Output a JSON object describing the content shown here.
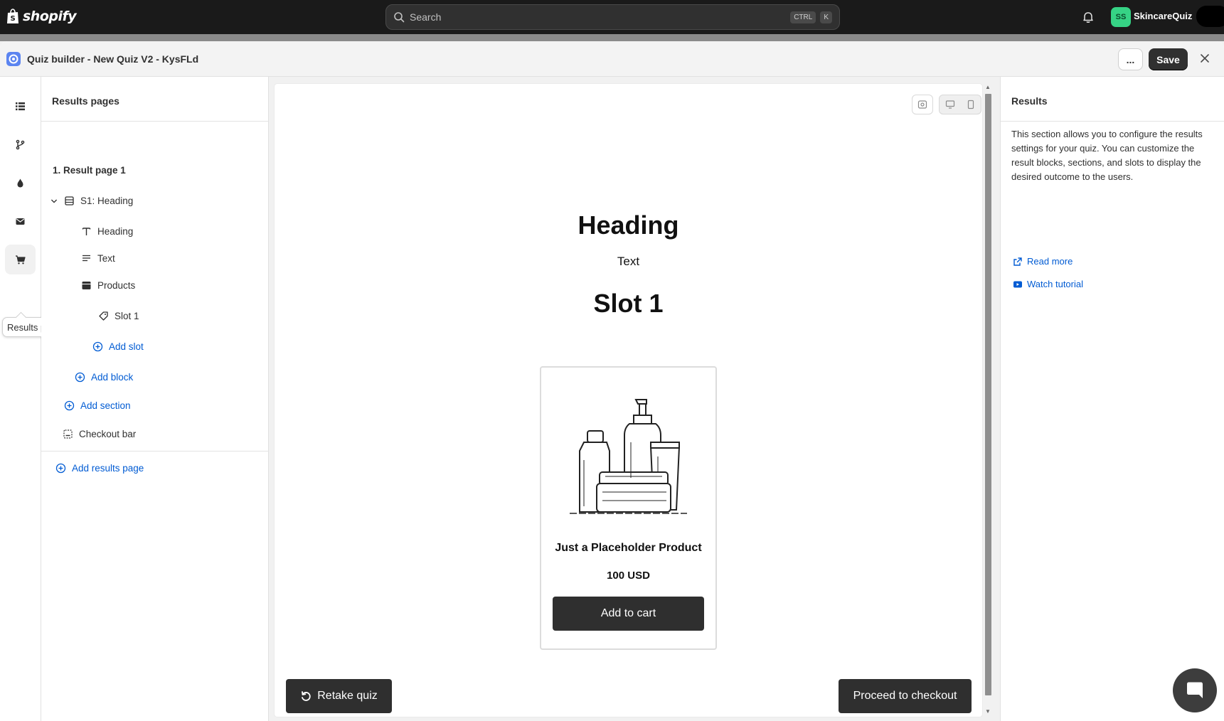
{
  "topbar": {
    "brand": "shopify",
    "search_placeholder": "Search",
    "shortcut_ctrl": "CTRL",
    "shortcut_k": "K",
    "avatar_initials": "SS",
    "store_name": "SkincareQuiz"
  },
  "modal": {
    "title": "Quiz builder - New Quiz V2 - KysFLd",
    "more_label": "...",
    "save_label": "Save"
  },
  "rail": {
    "tooltip": "Results pages"
  },
  "left_panel": {
    "title": "Results pages",
    "page_item": "1. Result page 1",
    "section_item": "S1: Heading",
    "blocks": [
      "Heading",
      "Text",
      "Products"
    ],
    "slot_item": "Slot 1",
    "add_slot": "Add slot",
    "add_block": "Add block",
    "add_section": "Add section",
    "checkout_bar": "Checkout bar",
    "add_results_page": "Add results page"
  },
  "preview": {
    "heading": "Heading",
    "text": "Text",
    "slot_title": "Slot 1",
    "product_name": "Just a Placeholder Product",
    "product_price": "100 USD",
    "add_to_cart": "Add to cart",
    "retake": "Retake quiz",
    "checkout": "Proceed to checkout"
  },
  "right_panel": {
    "title": "Results",
    "description": "This section allows you to configure the results settings for your quiz. You can customize the result blocks, sections, and slots to display the desired outcome to the users.",
    "read_more": "Read more",
    "watch_tutorial": "Watch tutorial"
  },
  "colors": {
    "topbar_bg": "#1a1a1a",
    "link": "#005bd3",
    "primary_button": "#303030",
    "avatar": "#36d385"
  }
}
